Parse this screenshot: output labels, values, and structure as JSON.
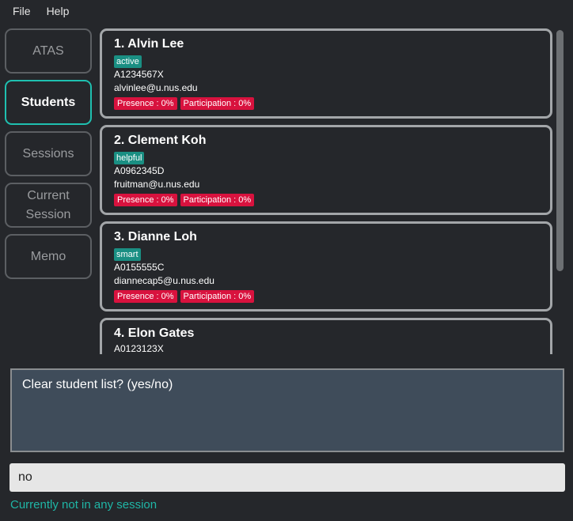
{
  "menu": {
    "file": "File",
    "help": "Help"
  },
  "sidebar": {
    "items": [
      {
        "label": "ATAS",
        "active": false
      },
      {
        "label": "Students",
        "active": true
      },
      {
        "label": "Sessions",
        "active": false
      },
      {
        "label": "Current Session",
        "active": false
      },
      {
        "label": "Memo",
        "active": false
      }
    ]
  },
  "students": [
    {
      "name": "1.  Alvin Lee",
      "tag": "active",
      "matric": "A1234567X",
      "email": "alvinlee@u.nus.edu",
      "presence": "Presence : 0%",
      "participation": "Participation : 0%"
    },
    {
      "name": "2.  Clement Koh",
      "tag": "helpful",
      "matric": "A0962345D",
      "email": "fruitman@u.nus.edu",
      "presence": "Presence : 0%",
      "participation": "Participation : 0%"
    },
    {
      "name": "3.  Dianne Loh",
      "tag": "smart",
      "matric": "A0155555C",
      "email": "diannecap5@u.nus.edu",
      "presence": "Presence : 0%",
      "participation": "Participation : 0%"
    },
    {
      "name": "4.  Elon Gates",
      "matric": "A0123123X"
    }
  ],
  "result": {
    "text": "Clear student list? (yes/no)"
  },
  "command": {
    "value": "no"
  },
  "status": {
    "text": "Currently not in any session"
  },
  "colors": {
    "accent": "#1fc0b0",
    "tag": "#1a8f83",
    "stat": "#d8123e",
    "background": "#25272b"
  }
}
